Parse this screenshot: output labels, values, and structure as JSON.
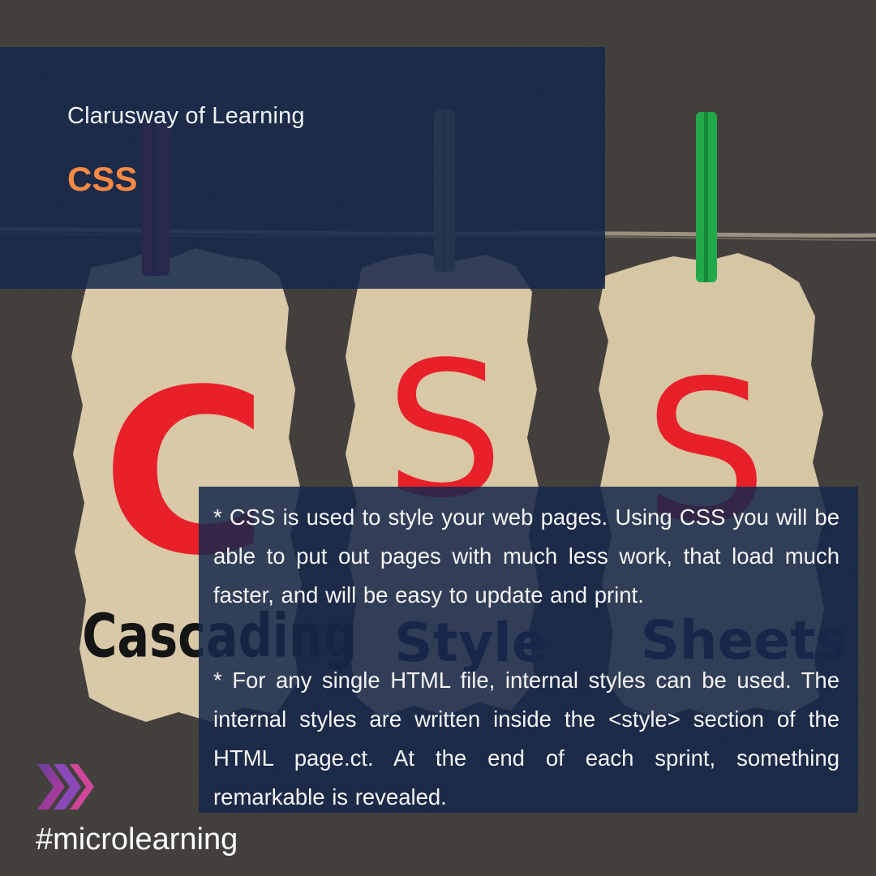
{
  "header": {
    "brand": "Clarusway of Learning",
    "topic": "CSS"
  },
  "photo": {
    "letters": [
      "C",
      "S",
      "S"
    ],
    "words": [
      "Cascading",
      "Style",
      "Sheets"
    ],
    "letter_color": "#e8202a",
    "clothespin_colors": [
      "#8b2a55",
      "#7f8a58",
      "#22a84a"
    ]
  },
  "body": {
    "paragraph_1": "* CSS is used to style your web pages. Using CSS you will be able to put out pages with much less work, that load much faster, and will be easy to update and print.",
    "paragraph_2": "*  For any single HTML file, internal styles can be used. The internal styles are written inside the <style> section of the HTML page.ct. At the end of each sprint, something remarkable is revealed."
  },
  "footer": {
    "hashtag": "#microlearning",
    "logo_icon": "chevrons-icon"
  },
  "colors": {
    "panel": "#16284a",
    "accent": "#f58a45"
  }
}
